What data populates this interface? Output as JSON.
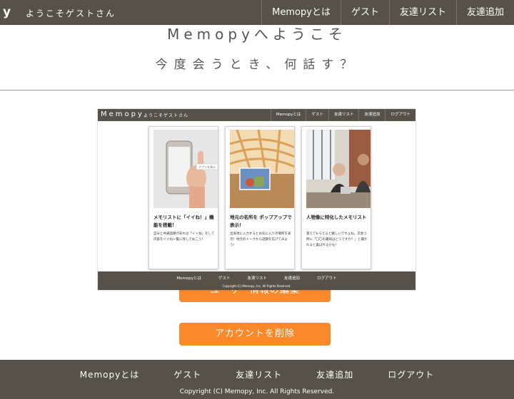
{
  "nav": {
    "logo": "y",
    "welcome": "ようこそゲストさん",
    "items": [
      "Memopyとは",
      "ゲスト",
      "友達リスト",
      "友達追加"
    ]
  },
  "hero": {
    "title": "Memopyへようこそ",
    "subtitle": "今度会うとき、何話す？"
  },
  "buttons": {
    "edit_profile": "ユーザー情報の編集",
    "delete_account": "アカウントを削除"
  },
  "footer": {
    "links": [
      "Memopyとは",
      "ゲスト",
      "友達リスト",
      "友達追加",
      "ログアウト"
    ],
    "copyright": "Copyright (C) Memopy, Inc. All Rights Reserved."
  },
  "preview": {
    "nav": {
      "logo": "Memopy",
      "welcome": "ようこそゲストさん",
      "items": [
        "Memopyとは",
        "ゲスト",
        "友達リスト",
        "友達追加",
        "ログアウト"
      ]
    },
    "cards": [
      {
        "title": "メモリストに「イイね！」機能を搭載！",
        "desc": "自分と共通話題があれば「イイね」をして 内容をイイね一覧に残しておこう！",
        "badge": "アプリを表示"
      },
      {
        "title": "地元の名所を ポップアップで表示！",
        "desc": "出身地に入力するとお気に入りの場所を表示！地元のトークから話題を広げてみよう！"
      },
      {
        "title": "人物像に特化したメモリスト",
        "desc": "覚えてもらえると嬉しいですよね。次会う時に「〇〇の趣味はどうですか？」と聞かれると喜ばれるかも！"
      }
    ],
    "footer": {
      "links": [
        "Memopyとは",
        "ゲスト",
        "友達リスト",
        "友達追加",
        "ログアウト"
      ],
      "copyright": "Copyright (C) Memopy, Inc. All Rights Reserved."
    }
  },
  "colors": {
    "nav_bg": "#575249",
    "accent": "#f9892a",
    "text": "#555555"
  }
}
